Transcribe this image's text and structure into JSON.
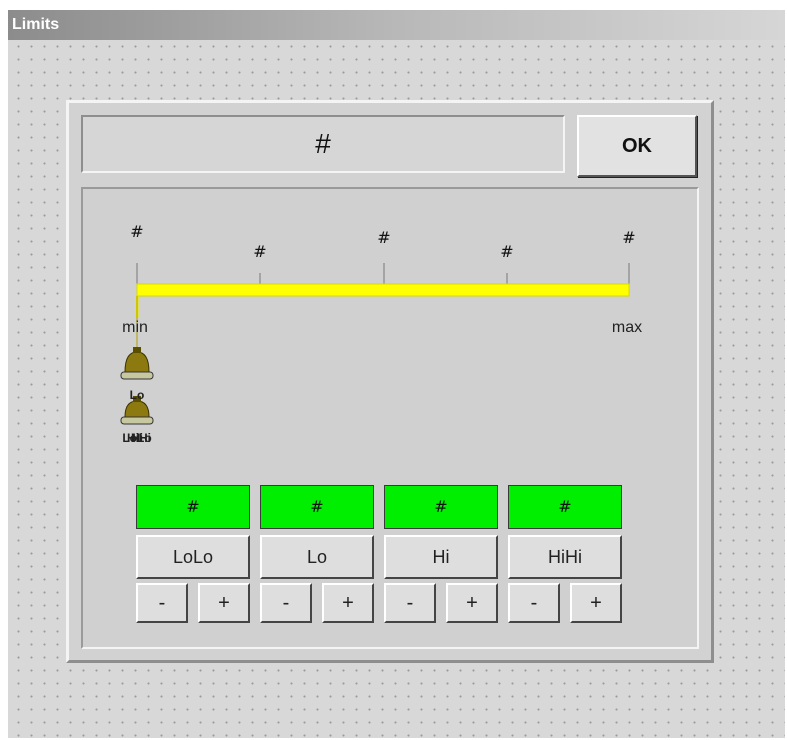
{
  "window": {
    "title": "Limits"
  },
  "header": {
    "value_display": "#",
    "ok_label": "OK"
  },
  "scale": {
    "tick_labels": [
      "#",
      "#",
      "#",
      "#",
      "#"
    ],
    "min_label": "min",
    "max_label": "max",
    "bar_color": "#ffff00",
    "bell_labels": [
      "LoLo",
      "Lo",
      "Hi",
      "HiHi"
    ]
  },
  "limits": [
    {
      "value": "#",
      "name": "LoLo",
      "minus": "-",
      "plus": "+"
    },
    {
      "value": "#",
      "name": "Lo",
      "minus": "-",
      "plus": "+"
    },
    {
      "value": "#",
      "name": "Hi",
      "minus": "-",
      "plus": "+"
    },
    {
      "value": "#",
      "name": "HiHi",
      "minus": "-",
      "plus": "+"
    }
  ],
  "colors": {
    "value_box": "#00ee00",
    "bell": "#8c7a10"
  }
}
